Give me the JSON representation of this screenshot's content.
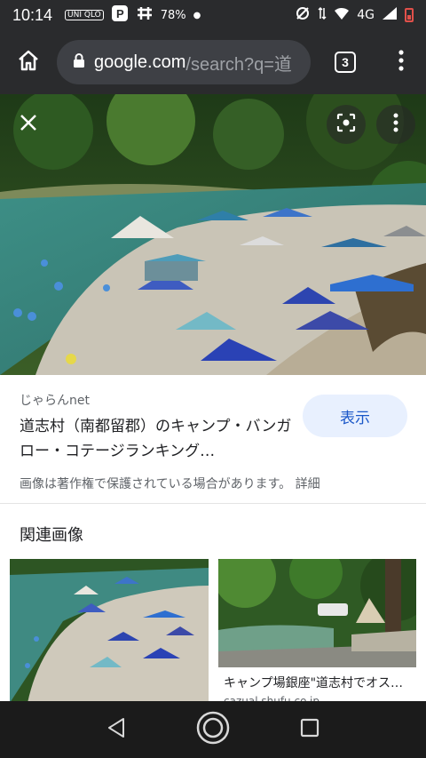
{
  "status_bar": {
    "time": "10:14",
    "icons": [
      "uniqlo-icon",
      "p-icon",
      "app-icon"
    ],
    "uniqlo_label": "UNI QLO",
    "battery_text": "78%",
    "network": "4G"
  },
  "browser": {
    "url_host": "google.com",
    "url_path": "/search?q=道",
    "tab_count": "3"
  },
  "result": {
    "source": "じゃらんnet",
    "title": "道志村（南都留郡）のキャンプ・バンガロー・コテージランキング…",
    "view_button": "表示",
    "copyright": "画像は著作権で保護されている場合があります。 詳細"
  },
  "related": {
    "heading": "関連画像",
    "items": [
      {
        "caption": "",
        "domain": ""
      },
      {
        "caption": "キャンプ場銀座\"道志村でオス…",
        "domain": "cazual.shufu.co.jp"
      }
    ]
  },
  "colors": {
    "chrome_bar": "#2a2b2d",
    "url_pill": "#3e4045",
    "view_button_bg": "#e8f0fe",
    "view_button_text": "#1a57c8",
    "battery": "#e0504a"
  }
}
